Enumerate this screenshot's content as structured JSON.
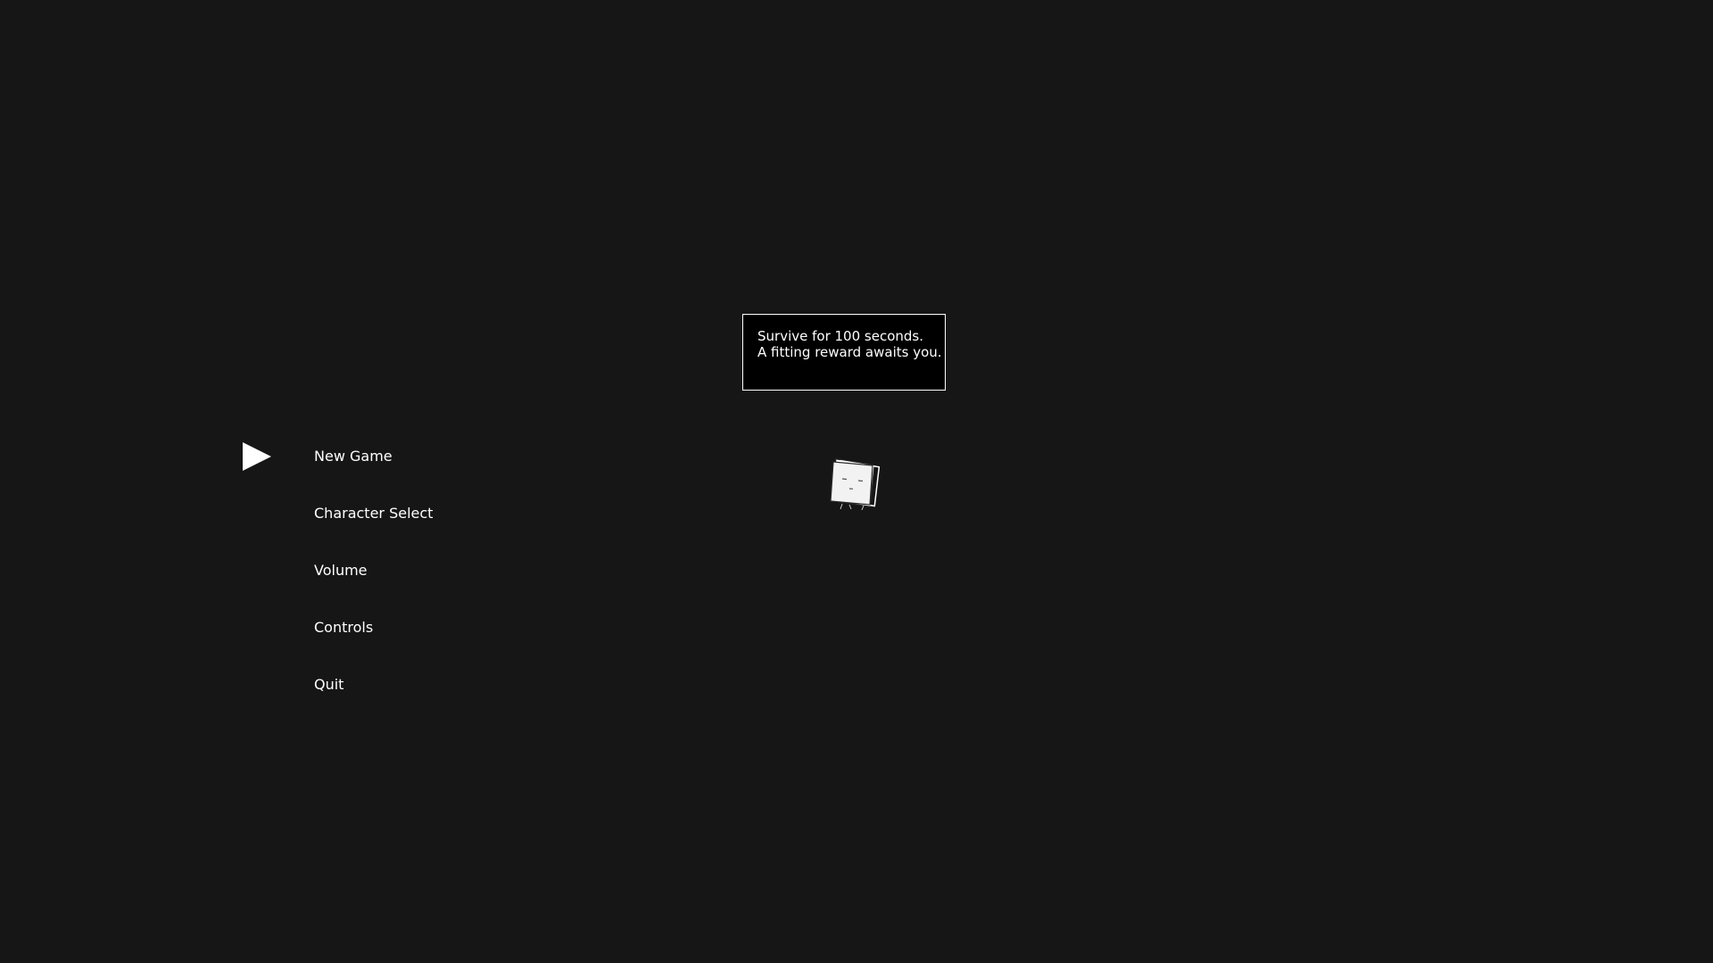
{
  "hint": {
    "line1": "Survive for 100 seconds.",
    "line2": "A fitting reward awaits you."
  },
  "menu": {
    "selected_index": 0,
    "items": [
      {
        "label": "New Game"
      },
      {
        "label": "Character Select"
      },
      {
        "label": "Volume"
      },
      {
        "label": "Controls"
      },
      {
        "label": "Quit"
      }
    ]
  },
  "colors": {
    "background": "#161616",
    "text": "#ffffff",
    "hint_background": "#000000"
  },
  "icons": {
    "cursor": "play-arrow-icon",
    "character": "cube-character-sprite"
  }
}
